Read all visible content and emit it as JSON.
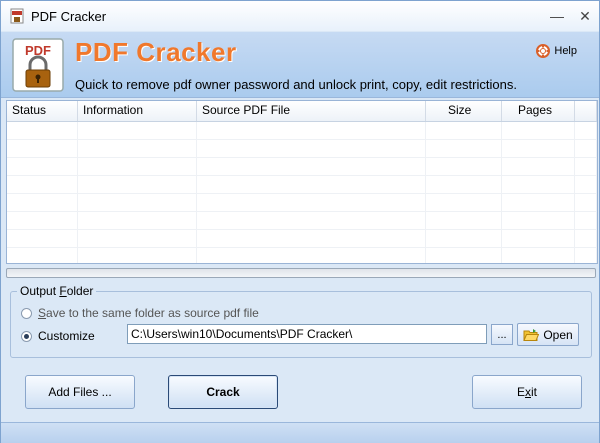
{
  "window": {
    "title": "PDF Cracker",
    "minimize": "—",
    "close": "✕"
  },
  "header": {
    "logo_text": "PDF",
    "app_name": "PDF Cracker",
    "tagline": "Quick to remove pdf owner password and unlock print, copy, edit restrictions.",
    "help_label": "Help"
  },
  "table": {
    "columns": [
      "Status",
      "Information",
      "Source PDF File",
      "Size",
      "Pages"
    ],
    "rows": []
  },
  "progress": {
    "value": 0
  },
  "output": {
    "legend_pre": "Output ",
    "legend_hot": "F",
    "legend_post": "older",
    "option_same_pre": "",
    "option_same_hot": "S",
    "option_same_post": "ave to the same folder as source pdf file",
    "option_custom": "Customize",
    "path_value": "C:\\Users\\win10\\Documents\\PDF Cracker\\",
    "browse_label": "...",
    "open_label": "Open"
  },
  "buttons": {
    "add_files": "Add Files ...",
    "crack": "Crack",
    "exit_pre": "E",
    "exit_hot": "x",
    "exit_post": "it"
  },
  "colors": {
    "accent": "#f0782c",
    "window_bg": "#dbe8f6",
    "header_bg": "#aacbee"
  }
}
